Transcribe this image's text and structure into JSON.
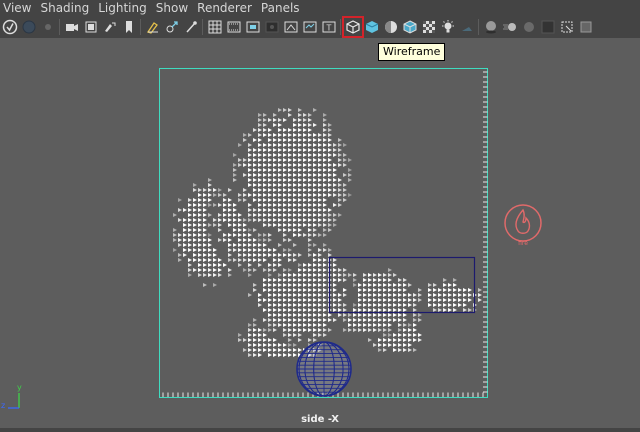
{
  "menu": [
    "View",
    "Shading",
    "Lighting",
    "Show",
    "Renderer",
    "Panels"
  ],
  "toolbar": {
    "icons": [
      "select-camera-icon",
      "camera-attributes-icon",
      "bookmarks-icon",
      "image-plane-icon",
      "two-d-pan-zoom-icon",
      "grease-pencil-icon",
      "grid-icon",
      "film-gate-icon",
      "resolution-gate-icon",
      "gate-mask-icon",
      "field-chart-icon",
      "safe-action-icon",
      "safe-title-icon",
      "wireframe-icon",
      "smooth-shade-icon",
      "flat-shade-icon",
      "bounding-box-icon",
      "use-default-material-icon",
      "textured-icon",
      "lights-icon",
      "shadows-icon",
      "ambient-occlusion-icon",
      "motion-blur-icon",
      "anti-aliasing-icon",
      "depth-of-field-icon",
      "isolate-select-icon",
      "xray-icon",
      "xray-joints-icon"
    ],
    "active": "wireframe-icon",
    "tooltip": "Wireframe"
  },
  "viewport": {
    "camera_label": "side -X",
    "fire_label": "fire",
    "axis": {
      "y": "y",
      "z": "z"
    }
  },
  "colors": {
    "viewport_bg": "#5d5d5d",
    "container": "#3fdcc0",
    "selection_box": "#1c1a6e",
    "sphere": "#1f2a8a",
    "fire_icon": "#e06a6a",
    "highlight": "#d3232a"
  }
}
